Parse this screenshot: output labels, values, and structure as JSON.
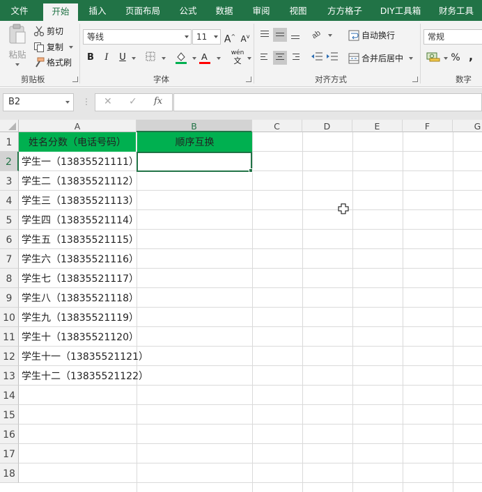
{
  "tabs": [
    {
      "label": "文件",
      "active": false
    },
    {
      "label": "开始",
      "active": true
    },
    {
      "label": "插入",
      "active": false
    },
    {
      "label": "页面布局",
      "active": false
    },
    {
      "label": "公式",
      "active": false
    },
    {
      "label": "数据",
      "active": false
    },
    {
      "label": "审阅",
      "active": false
    },
    {
      "label": "视图",
      "active": false
    },
    {
      "label": "方方格子",
      "active": false
    },
    {
      "label": "DIY工具箱",
      "active": false
    },
    {
      "label": "财务工具",
      "active": false
    }
  ],
  "clipboard": {
    "paste_label": "粘贴",
    "cut_label": "剪切",
    "copy_label": "复制",
    "format_painter_label": "格式刷",
    "group_label": "剪贴板"
  },
  "font": {
    "font_name": "等线",
    "font_size": "11",
    "bold": "B",
    "italic": "I",
    "underline": "U",
    "phonetic": "wén",
    "group_label": "字体"
  },
  "alignment": {
    "wrap_text_label": "自动换行",
    "merge_center_label": "合并后居中",
    "group_label": "对齐方式"
  },
  "number": {
    "format": "常规",
    "percent": "%",
    "comma": ",",
    "group_label": "数字"
  },
  "formula_bar": {
    "name_box": "B2",
    "cancel": "✕",
    "enter": "✓",
    "fx": "fx",
    "formula": ""
  },
  "columns": [
    "A",
    "B",
    "C",
    "D",
    "E",
    "F",
    "G"
  ],
  "rows": [
    "1",
    "2",
    "3",
    "4",
    "5",
    "6",
    "7",
    "8",
    "9",
    "10",
    "11",
    "12",
    "13",
    "14",
    "15",
    "16",
    "17",
    "18"
  ],
  "sheet": {
    "header_a": "姓名分数（电话号码）",
    "header_b": "顺序互换",
    "col_a": [
      "学生一（13835521111）",
      "学生二（13835521112）",
      "学生三（13835521113）",
      "学生四（13835521114）",
      "学生五（13835521115）",
      "学生六（13835521116）",
      "学生七（13835521117）",
      "学生八（13835521118）",
      "学生九（13835521119）",
      "学生十（13835521120）",
      "学生十一（13835521121）",
      "学生十二（13835521122）"
    ]
  },
  "colors": {
    "ribbon_green": "#217346",
    "header_fill": "#00b050",
    "fill_color_bar": "#00b050",
    "font_color_bar": "#ff0000"
  }
}
